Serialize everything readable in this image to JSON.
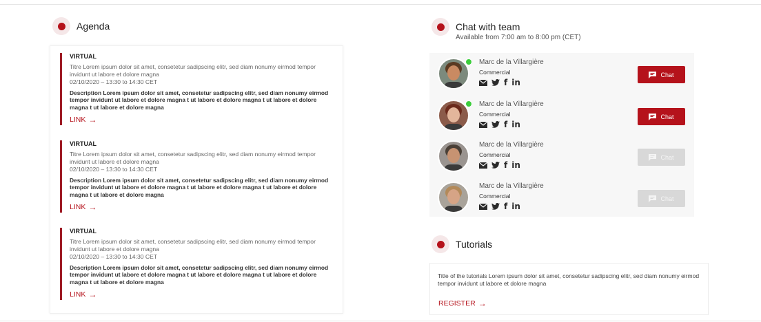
{
  "agenda": {
    "title": "Agenda",
    "items": [
      {
        "type": "VIRTUAL",
        "title": "Titre Lorem ipsum dolor sit amet, consetetur sadipscing elitr, sed diam nonumy eirmod tempor invidunt ut labore et dolore magna",
        "date": "02/10/2020 – 13:30 to 14:30 CET",
        "description": "Description Lorem ipsum dolor sit amet, consetetur sadipscing elitr, sed diam nonumy eirmod tempor invidunt ut labore et dolore magna t ut labore et dolore magna t ut labore et dolore magna t ut labore et dolore magna",
        "link_label": "LINK"
      },
      {
        "type": "VIRTUAL",
        "title": "Titre Lorem ipsum dolor sit amet, consetetur sadipscing elitr, sed diam nonumy eirmod tempor invidunt ut labore et dolore magna",
        "date": "02/10/2020 – 13:30 to 14:30 CET",
        "description": "Description Lorem ipsum dolor sit amet, consetetur sadipscing elitr, sed diam nonumy eirmod tempor invidunt ut labore et dolore magna t ut labore et dolore magna t ut labore et dolore magna t ut labore et dolore magna",
        "link_label": "LINK"
      },
      {
        "type": "VIRTUAL",
        "title": "Titre Lorem ipsum dolor sit amet, consetetur sadipscing elitr, sed diam nonumy eirmod tempor invidunt ut labore et dolore magna",
        "date": "02/10/2020 – 13:30 to 14:30 CET",
        "description": "Description Lorem ipsum dolor sit amet, consetetur sadipscing elitr, sed diam nonumy eirmod tempor invidunt ut labore et dolore magna t ut labore et dolore magna t ut labore et dolore magna t ut labore et dolore magna",
        "link_label": "LINK"
      }
    ]
  },
  "chat": {
    "title": "Chat with team",
    "availability": "Available from 7:00 am to 8:00 pm (CET)",
    "members": [
      {
        "name": "Marc de la Villargière",
        "role": "Commercial",
        "online": true,
        "button_label": "Chat",
        "enabled": true,
        "avatar_skin": "#c98a62",
        "avatar_hair": "#5a3a22",
        "avatar_bg": "#7c8a7d"
      },
      {
        "name": "Marc de la Villargière",
        "role": "Commercial",
        "online": true,
        "button_label": "Chat",
        "enabled": true,
        "avatar_skin": "#e3b69b",
        "avatar_hair": "#6b2a1c",
        "avatar_bg": "#8b5b4a"
      },
      {
        "name": "Marc de la Villargière",
        "role": "Commercial",
        "online": false,
        "button_label": "Chat",
        "enabled": false,
        "avatar_skin": "#c79372",
        "avatar_hair": "#4a4037",
        "avatar_bg": "#9a9490"
      },
      {
        "name": "Marc de la Villargière",
        "role": "Commercial",
        "online": false,
        "button_label": "Chat",
        "enabled": false,
        "avatar_skin": "#d6a486",
        "avatar_hair": "#b38a5a",
        "avatar_bg": "#a9a39a"
      }
    ],
    "social_icons": [
      "mail-icon",
      "twitter-icon",
      "facebook-icon",
      "linkedin-icon"
    ]
  },
  "tutorials": {
    "title": "Tutorials",
    "text": "Title of the tutorials Lorem ipsum dolor sit amet, consetetur sadipscing elitr, sed diam nonumy eirmod tempor invidunt ut labore et dolore magna",
    "link_label": "REGISTER"
  },
  "colors": {
    "accent": "#b5121b",
    "online": "#3ccd3c",
    "disabled": "#d8d8d8"
  }
}
